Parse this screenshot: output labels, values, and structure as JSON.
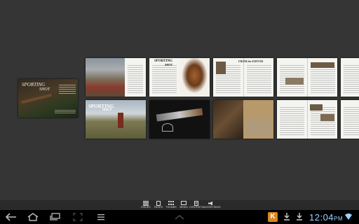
{
  "cover": {
    "title": "SPORTING",
    "subtitle": "SHOT"
  },
  "spreads_top": [
    {
      "id": "spread-hunting-field"
    },
    {
      "id": "spread-sporting-shot-pheasant",
      "logo_line1": "SPORTING",
      "logo_line2": "SHOT"
    },
    {
      "id": "spread-from-the-editor",
      "heading": "FROM the EDITOR"
    },
    {
      "id": "spread-gun-review"
    },
    {
      "id": "spread-partial"
    }
  ],
  "spreads_bottom": [
    {
      "id": "spread-sporting-shot-hunter",
      "logo_line1": "SPORTING",
      "logo_line2": "SHOT"
    },
    {
      "id": "spread-shotgun-ad"
    },
    {
      "id": "spread-history"
    },
    {
      "id": "spread-gun-review-2"
    },
    {
      "id": "spread-partial-2"
    }
  ],
  "toolbar": {
    "items": [
      {
        "label": "ISSUES",
        "icon": "stack-icon"
      },
      {
        "label": "PAGES",
        "icon": "pages-icon"
      },
      {
        "label": "THUMBS",
        "icon": "grid-icon"
      },
      {
        "label": "MEDIA",
        "icon": "media-icon"
      },
      {
        "label": "CONTENTS",
        "icon": "contents-icon"
      },
      {
        "label": "ADVERTISING",
        "icon": "megaphone-icon"
      }
    ]
  },
  "statusbar": {
    "time": "12:04",
    "ampm": "PM",
    "app_badge": "K"
  },
  "colors": {
    "background": "#353535",
    "taskbar": "#000000",
    "clock": "#9fd0ff",
    "badge": "#d9861f"
  }
}
